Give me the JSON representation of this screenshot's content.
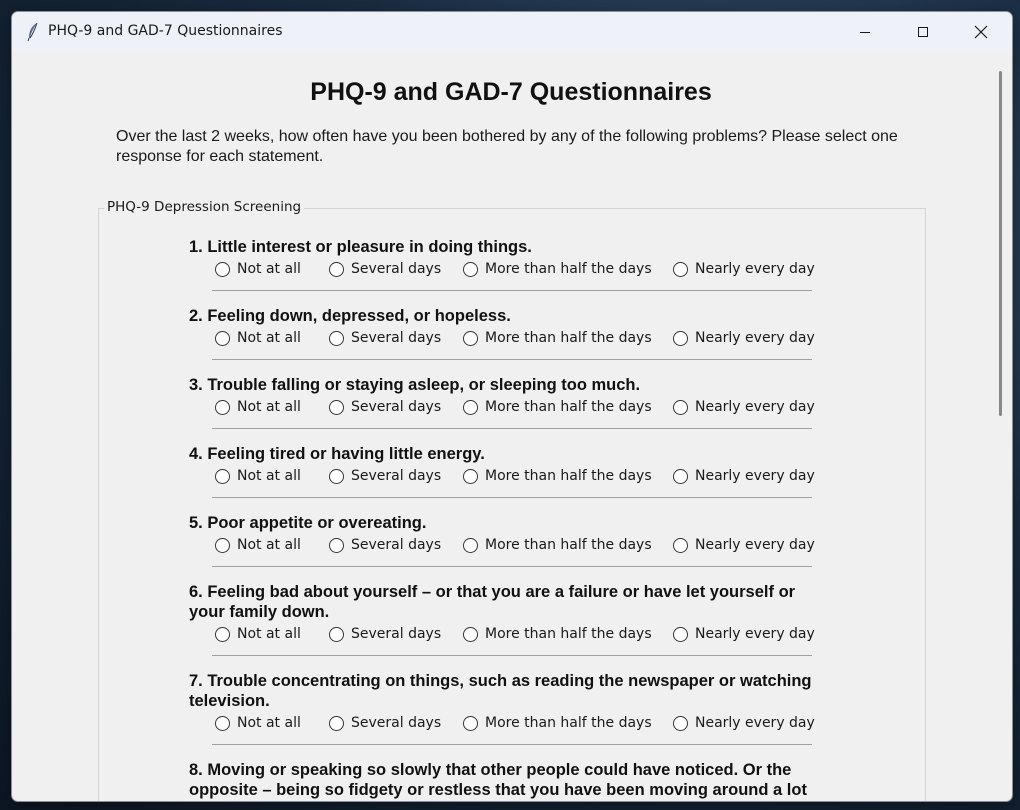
{
  "window": {
    "title": "PHQ-9 and GAD-7 Questionnaires",
    "icon": "feather-icon"
  },
  "header": {
    "title": "PHQ-9 and GAD-7 Questionnaires",
    "intro": "Over the last 2 weeks, how often have you been bothered by any of the following problems? Please select one response for each statement."
  },
  "phq9": {
    "legend": "PHQ-9 Depression Screening",
    "options": [
      "Not at all",
      "Several days",
      "More than half the days",
      "Nearly every day"
    ],
    "questions": [
      "1. Little interest or pleasure in doing things.",
      "2. Feeling down, depressed, or hopeless.",
      "3. Trouble falling or staying asleep, or sleeping too much.",
      "4. Feeling tired or having little energy.",
      "5. Poor appetite or overeating.",
      "6. Feeling bad about yourself – or that you are a failure or have let yourself or your family down.",
      "7. Trouble concentrating on things, such as reading the newspaper or watching television.",
      "8. Moving or speaking so slowly that other people could have noticed. Or the opposite – being so fidgety or restless that you have been moving around a lot"
    ]
  },
  "colors": {
    "window_bg": "#f0f0f0",
    "titlebar_bg": "#eef1f7",
    "text": "#111111"
  }
}
